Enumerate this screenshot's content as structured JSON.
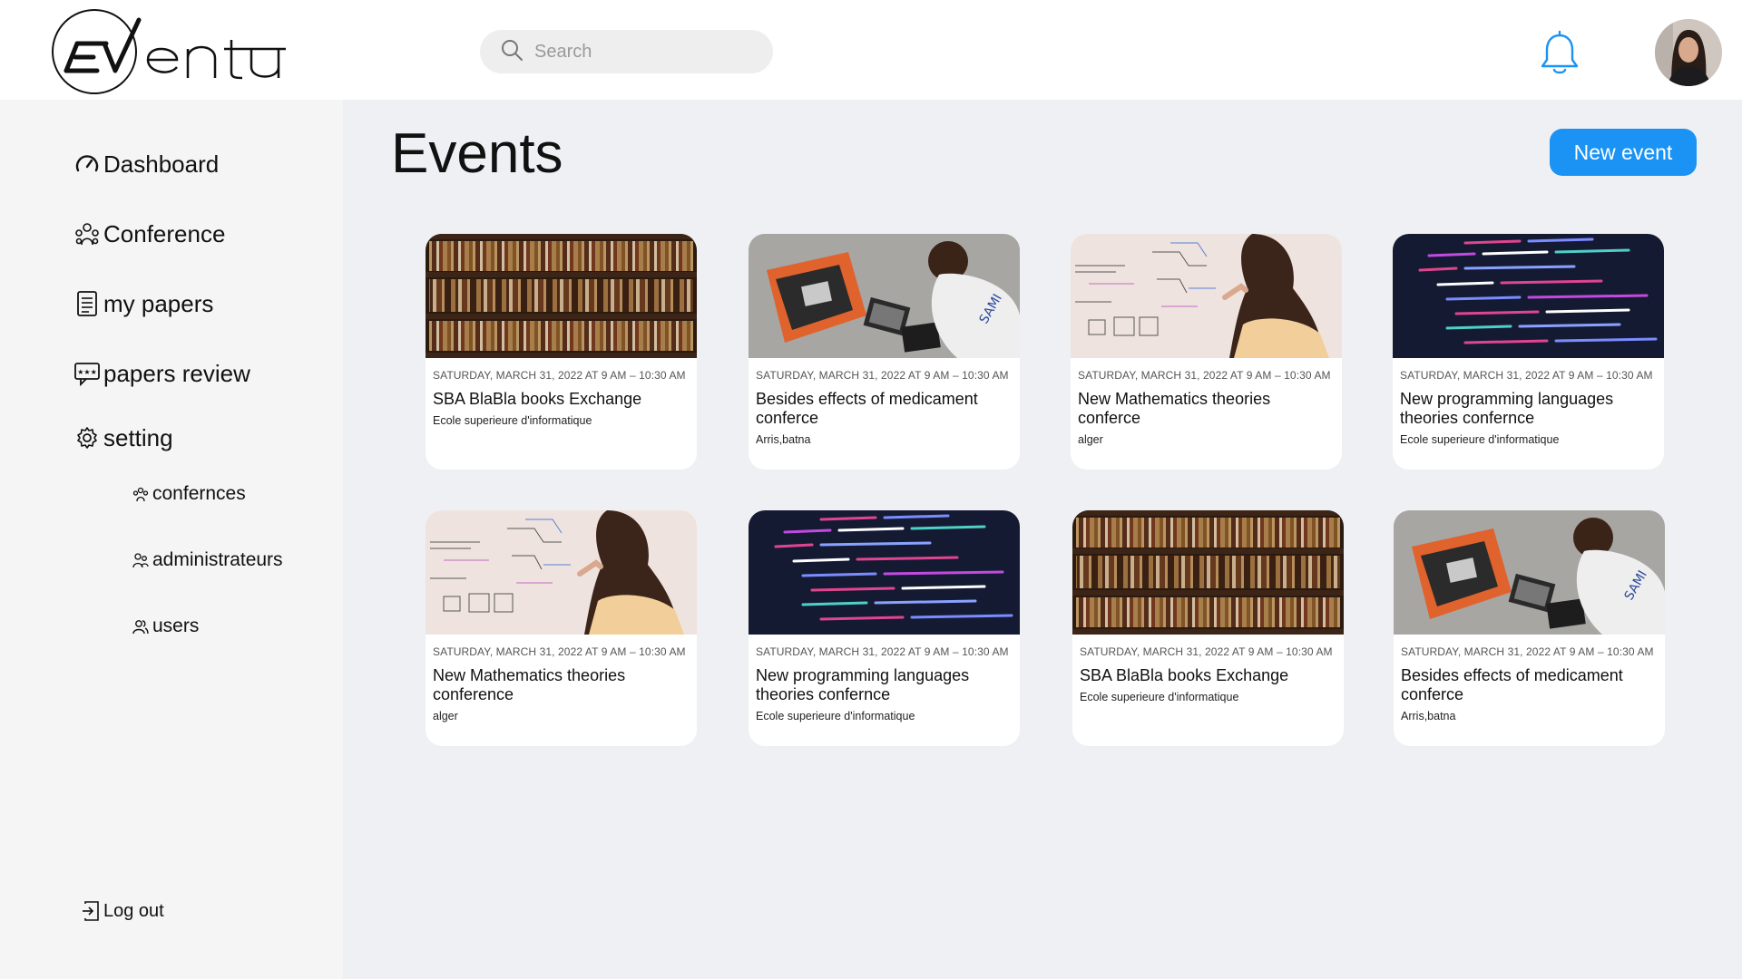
{
  "app": {
    "logo_text": "Eventu"
  },
  "header": {
    "search_placeholder": "Search",
    "icons": {
      "search": "search-icon",
      "notifications": "bell-icon"
    },
    "accent": "#1a93f4"
  },
  "sidebar": {
    "items": [
      {
        "label": "Dashboard",
        "icon": "gauge-icon"
      },
      {
        "label": "Conference",
        "icon": "group-icon"
      },
      {
        "label": "my papers",
        "icon": "document-icon"
      },
      {
        "label": "papers review",
        "icon": "review-icon"
      },
      {
        "label": "setting",
        "icon": "gear-icon"
      }
    ],
    "sub_items": [
      {
        "label": "confernces",
        "icon": "group-icon"
      },
      {
        "label": "administrateurs",
        "icon": "admins-icon"
      },
      {
        "label": "users",
        "icon": "users-icon"
      }
    ],
    "logout_label": "Log out"
  },
  "main": {
    "title": "Events",
    "new_event_label": "New event",
    "cards": [
      {
        "date": "SATURDAY, MARCH 31, 2022 AT 9 AM – 10:30 AM",
        "title": "SBA BlaBla books Exchange",
        "location": "Ecole superieure  d'informatique",
        "image": "bookshelf"
      },
      {
        "date": "SATURDAY, MARCH 31, 2022 AT 9 AM – 10:30 AM",
        "title": "Besides effects of medicament conferce",
        "location": "Arris,batna",
        "image": "workbench"
      },
      {
        "date": "SATURDAY, MARCH 31, 2022 AT 9 AM – 10:30 AM",
        "title": "New Mathematics theories conferce",
        "location": "alger",
        "image": "whiteboard"
      },
      {
        "date": "SATURDAY, MARCH 31, 2022 AT 9 AM – 10:30 AM",
        "title": "New programming languages theories confernce",
        "location": "Ecole superieure  d'informatique",
        "image": "code"
      },
      {
        "date": "SATURDAY, MARCH 31, 2022 AT 9 AM – 10:30 AM",
        "title": "New Mathematics theories conference",
        "location": "alger",
        "image": "whiteboard"
      },
      {
        "date": "SATURDAY, MARCH 31, 2022 AT 9 AM – 10:30 AM",
        "title": "New programming languages theories confernce",
        "location": "Ecole superieure  d'informatique",
        "image": "code"
      },
      {
        "date": "SATURDAY, MARCH 31, 2022 AT 9 AM – 10:30 AM",
        "title": "SBA BlaBla books Exchange",
        "location": "Ecole superieure  d'informatique",
        "image": "bookshelf"
      },
      {
        "date": "SATURDAY, MARCH 31, 2022 AT 9 AM – 10:30 AM",
        "title": "Besides effects of medicament conferce",
        "location": "Arris,batna",
        "image": "workbench"
      }
    ]
  }
}
